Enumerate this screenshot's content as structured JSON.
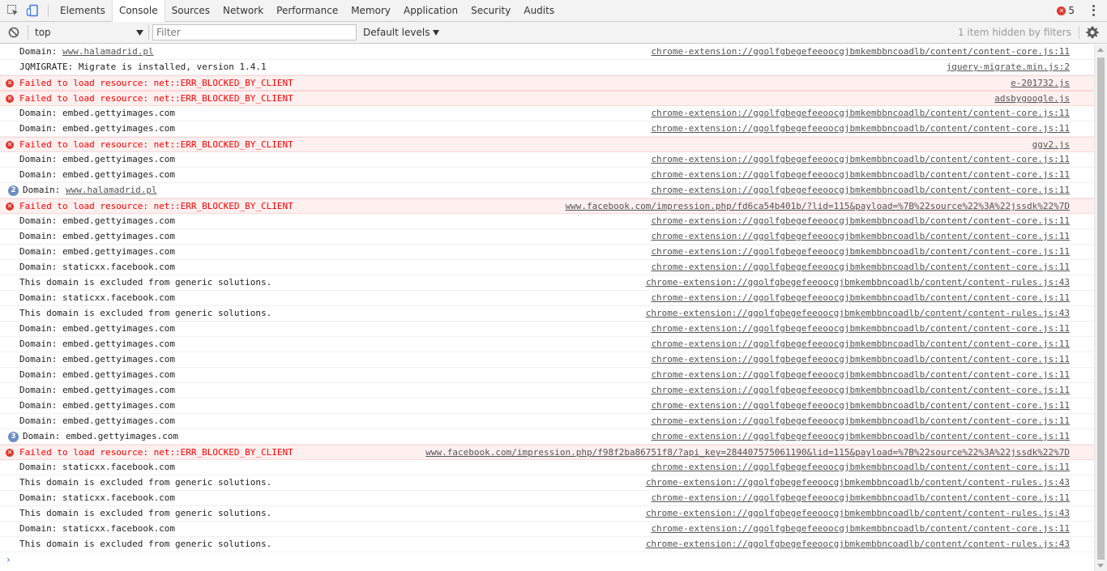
{
  "tabs": [
    "Elements",
    "Console",
    "Sources",
    "Network",
    "Performance",
    "Memory",
    "Application",
    "Security",
    "Audits"
  ],
  "active_tab": "Console",
  "error_count": "5",
  "toolbar": {
    "context": "top",
    "filter_placeholder": "Filter",
    "levels": "Default levels",
    "hidden_info": "1 item hidden by filters"
  },
  "messages": [
    {
      "type": "log",
      "text": "Domain: ",
      "link": "www.halamadrid.pl",
      "source": "chrome-extension://ggolfgbegefeeoocgjbmkembbncoadlb/content/content-core.js:11"
    },
    {
      "type": "log",
      "text": "JQMIGRATE: Migrate is installed, version 1.4.1",
      "source": "jquery-migrate.min.js:2"
    },
    {
      "type": "error",
      "text": "Failed to load resource: net::ERR_BLOCKED_BY_CLIENT",
      "source": "e-201732.js"
    },
    {
      "type": "error",
      "text": "Failed to load resource: net::ERR_BLOCKED_BY_CLIENT",
      "source": "adsbygoogle.js"
    },
    {
      "type": "log",
      "text": "Domain: embed.gettyimages.com",
      "source": "chrome-extension://ggolfgbegefeeoocgjbmkembbncoadlb/content/content-core.js:11"
    },
    {
      "type": "log",
      "text": "Domain: embed.gettyimages.com",
      "source": "chrome-extension://ggolfgbegefeeoocgjbmkembbncoadlb/content/content-core.js:11"
    },
    {
      "type": "error",
      "text": "Failed to load resource: net::ERR_BLOCKED_BY_CLIENT",
      "source": "ggv2.js"
    },
    {
      "type": "log",
      "text": "Domain: embed.gettyimages.com",
      "source": "chrome-extension://ggolfgbegefeeoocgjbmkembbncoadlb/content/content-core.js:11"
    },
    {
      "type": "log",
      "text": "Domain: embed.gettyimages.com",
      "source": "chrome-extension://ggolfgbegefeeoocgjbmkembbncoadlb/content/content-core.js:11"
    },
    {
      "type": "log",
      "repeat": "2",
      "text": "Domain: ",
      "link": "www.halamadrid.pl",
      "source": "chrome-extension://ggolfgbegefeeoocgjbmkembbncoadlb/content/content-core.js:11"
    },
    {
      "type": "error",
      "text": "Failed to load resource: net::ERR_BLOCKED_BY_CLIENT",
      "source": "www.facebook.com/impression.php/fd6ca54b401b/?lid=115&payload=%7B%22source%22%3A%22jssdk%22%7D"
    },
    {
      "type": "log",
      "text": "Domain: embed.gettyimages.com",
      "source": "chrome-extension://ggolfgbegefeeoocgjbmkembbncoadlb/content/content-core.js:11"
    },
    {
      "type": "log",
      "text": "Domain: embed.gettyimages.com",
      "source": "chrome-extension://ggolfgbegefeeoocgjbmkembbncoadlb/content/content-core.js:11"
    },
    {
      "type": "log",
      "text": "Domain: embed.gettyimages.com",
      "source": "chrome-extension://ggolfgbegefeeoocgjbmkembbncoadlb/content/content-core.js:11"
    },
    {
      "type": "log",
      "text": "Domain: staticxx.facebook.com",
      "source": "chrome-extension://ggolfgbegefeeoocgjbmkembbncoadlb/content/content-core.js:11"
    },
    {
      "type": "log",
      "text": "This domain is excluded from generic solutions.",
      "source": "chrome-extension://ggolfgbegefeeoocgjbmkembbncoadlb/content/content-rules.js:43"
    },
    {
      "type": "log",
      "text": "Domain: staticxx.facebook.com",
      "source": "chrome-extension://ggolfgbegefeeoocgjbmkembbncoadlb/content/content-core.js:11"
    },
    {
      "type": "log",
      "text": "This domain is excluded from generic solutions.",
      "source": "chrome-extension://ggolfgbegefeeoocgjbmkembbncoadlb/content/content-rules.js:43"
    },
    {
      "type": "log",
      "text": "Domain: embed.gettyimages.com",
      "source": "chrome-extension://ggolfgbegefeeoocgjbmkembbncoadlb/content/content-core.js:11"
    },
    {
      "type": "log",
      "text": "Domain: embed.gettyimages.com",
      "source": "chrome-extension://ggolfgbegefeeoocgjbmkembbncoadlb/content/content-core.js:11"
    },
    {
      "type": "log",
      "text": "Domain: embed.gettyimages.com",
      "source": "chrome-extension://ggolfgbegefeeoocgjbmkembbncoadlb/content/content-core.js:11"
    },
    {
      "type": "log",
      "text": "Domain: embed.gettyimages.com",
      "source": "chrome-extension://ggolfgbegefeeoocgjbmkembbncoadlb/content/content-core.js:11"
    },
    {
      "type": "log",
      "text": "Domain: embed.gettyimages.com",
      "source": "chrome-extension://ggolfgbegefeeoocgjbmkembbncoadlb/content/content-core.js:11"
    },
    {
      "type": "log",
      "text": "Domain: embed.gettyimages.com",
      "source": "chrome-extension://ggolfgbegefeeoocgjbmkembbncoadlb/content/content-core.js:11"
    },
    {
      "type": "log",
      "text": "Domain: embed.gettyimages.com",
      "source": "chrome-extension://ggolfgbegefeeoocgjbmkembbncoadlb/content/content-core.js:11"
    },
    {
      "type": "log",
      "repeat": "3",
      "text": "Domain: embed.gettyimages.com",
      "source": "chrome-extension://ggolfgbegefeeoocgjbmkembbncoadlb/content/content-core.js:11"
    },
    {
      "type": "error",
      "text": "Failed to load resource: net::ERR_BLOCKED_BY_CLIENT",
      "source": "www.facebook.com/impression.php/f98f2ba86751f8/?api_key=284407575061190&lid=115&payload=%7B%22source%22%3A%22jssdk%22%7D"
    },
    {
      "type": "log",
      "text": "Domain: staticxx.facebook.com",
      "source": "chrome-extension://ggolfgbegefeeoocgjbmkembbncoadlb/content/content-core.js:11"
    },
    {
      "type": "log",
      "text": "This domain is excluded from generic solutions.",
      "source": "chrome-extension://ggolfgbegefeeoocgjbmkembbncoadlb/content/content-rules.js:43"
    },
    {
      "type": "log",
      "text": "Domain: staticxx.facebook.com",
      "source": "chrome-extension://ggolfgbegefeeoocgjbmkembbncoadlb/content/content-core.js:11"
    },
    {
      "type": "log",
      "text": "This domain is excluded from generic solutions.",
      "source": "chrome-extension://ggolfgbegefeeoocgjbmkembbncoadlb/content/content-rules.js:43"
    },
    {
      "type": "log",
      "text": "Domain: staticxx.facebook.com",
      "source": "chrome-extension://ggolfgbegefeeoocgjbmkembbncoadlb/content/content-core.js:11"
    },
    {
      "type": "log",
      "text": "This domain is excluded from generic solutions.",
      "source": "chrome-extension://ggolfgbegefeeoocgjbmkembbncoadlb/content/content-rules.js:43"
    }
  ],
  "prompt": "›"
}
